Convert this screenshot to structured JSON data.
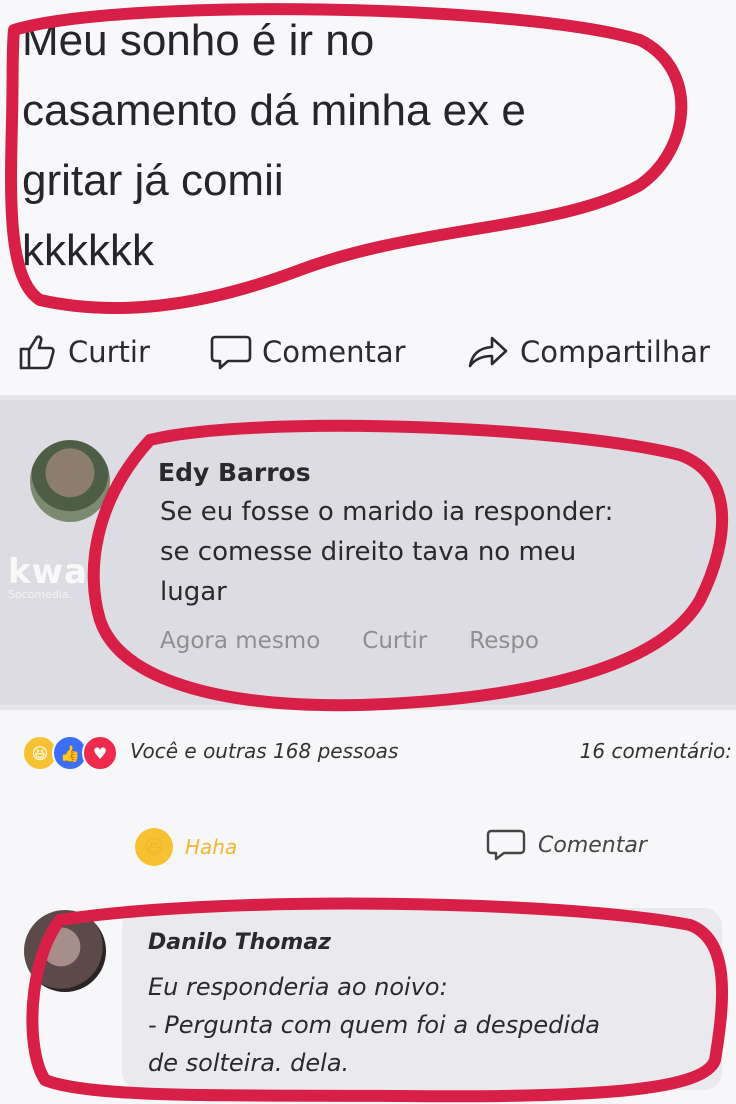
{
  "post": {
    "text": "Meu sonho é ir no\ncasamento dá minha ex e\ngritar já comii\nkkkkkk",
    "actions": [
      {
        "label": "Curtir",
        "icon": "thumbs-up-icon"
      },
      {
        "label": "Comentar",
        "icon": "speech-bubble-icon"
      },
      {
        "label": "Compartilhar",
        "icon": "share-arrow-icon"
      }
    ]
  },
  "reply": {
    "author": "Edy Barros",
    "text": "Se eu fosse o marido ia responder:\nse comesse direito tava no meu\nlugar",
    "time": "Agora mesmo",
    "like_label": "Curtir",
    "reply_label": "Respo"
  },
  "watermark": {
    "logo": "kwai",
    "sub": "Socomedia."
  },
  "reactions": {
    "icons": [
      "haha-icon",
      "like-icon",
      "love-icon"
    ],
    "summary": "Você e outras 168 pessoas",
    "comments_count": "16 comentário:"
  },
  "comment_actions": {
    "haha_label": "Haha",
    "comment_label": "Comentar"
  },
  "comment": {
    "author": "Danilo Thomaz",
    "text": "Eu responderia ao noivo:\n- Pergunta com quem foi a despedida\nde solteira. dela."
  },
  "colors": {
    "highlight_ring": "#d81f45",
    "haha_yellow": "#f6c232",
    "like_blue": "#3b6ff5",
    "love_red": "#ee2b4d"
  }
}
